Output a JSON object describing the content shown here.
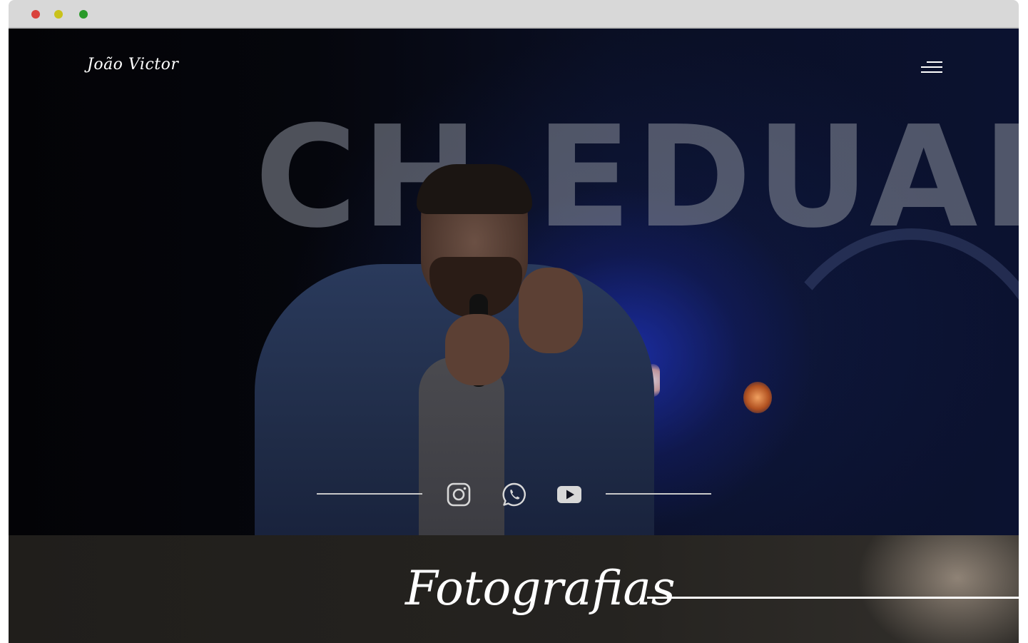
{
  "window": {
    "controls": [
      "close",
      "minimize",
      "maximize"
    ],
    "colors": {
      "close": "#d9423c",
      "minimize": "#c9c21b",
      "maximize": "#2a9a2a"
    }
  },
  "header": {
    "logo_text": "João Victor",
    "menu_icon": "hamburger-menu-icon"
  },
  "hero": {
    "background_sign_text": "CH EDUARDO",
    "social_links": [
      {
        "name": "instagram",
        "icon": "instagram-icon"
      },
      {
        "name": "whatsapp",
        "icon": "whatsapp-icon"
      },
      {
        "name": "youtube",
        "icon": "youtube-icon"
      }
    ]
  },
  "section": {
    "title": "Fotografias"
  },
  "colors": {
    "text": "#ffffff",
    "hero_bg": "#05060c",
    "section_bg": "#252320"
  }
}
